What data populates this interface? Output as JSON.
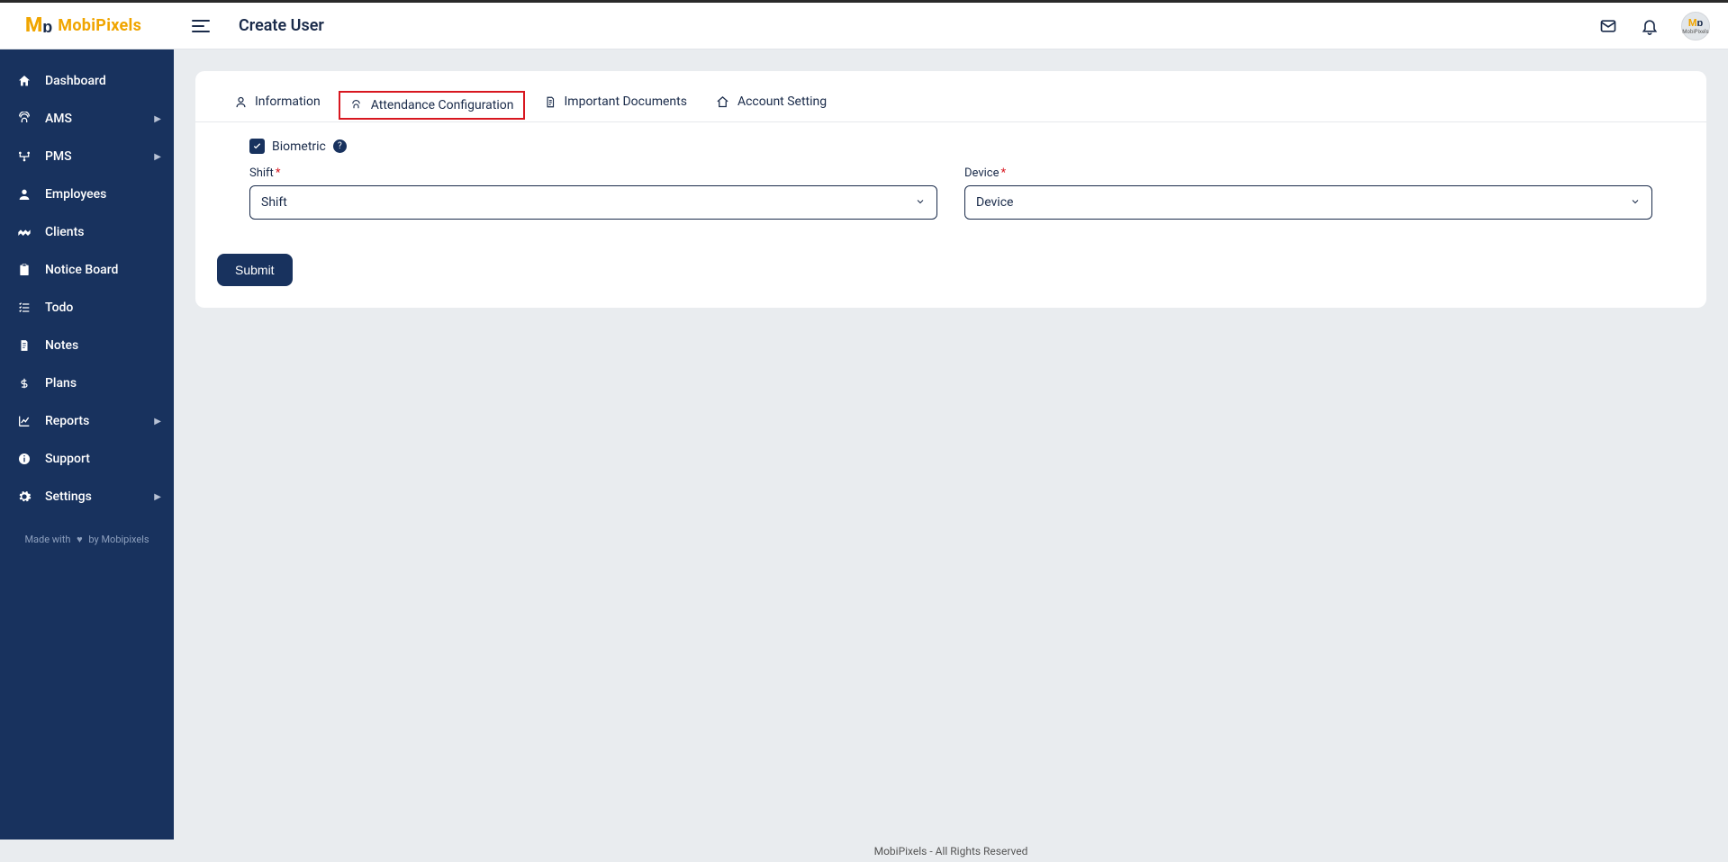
{
  "brand": {
    "logo_text": "MobiPixels"
  },
  "header": {
    "page_title": "Create User",
    "avatar_text": "MobiPixels"
  },
  "sidebar": {
    "items": [
      {
        "label": "Dashboard",
        "icon": "home-icon",
        "expandable": false
      },
      {
        "label": "AMS",
        "icon": "fingerprint-icon",
        "expandable": true
      },
      {
        "label": "PMS",
        "icon": "network-icon",
        "expandable": true
      },
      {
        "label": "Employees",
        "icon": "user-icon",
        "expandable": false
      },
      {
        "label": "Clients",
        "icon": "handshake-icon",
        "expandable": false
      },
      {
        "label": "Notice Board",
        "icon": "clipboard-icon",
        "expandable": false
      },
      {
        "label": "Todo",
        "icon": "list-icon",
        "expandable": false
      },
      {
        "label": "Notes",
        "icon": "note-icon",
        "expandable": false
      },
      {
        "label": "Plans",
        "icon": "dollar-icon",
        "expandable": false
      },
      {
        "label": "Reports",
        "icon": "chart-icon",
        "expandable": true
      },
      {
        "label": "Support",
        "icon": "info-icon",
        "expandable": false
      },
      {
        "label": "Settings",
        "icon": "gear-icon",
        "expandable": true
      }
    ],
    "made_with_prefix": "Made with",
    "made_with_suffix": "by Mobipixels"
  },
  "tabs": [
    {
      "label": "Information",
      "icon": "person-icon",
      "active": false
    },
    {
      "label": "Attendance Configuration",
      "icon": "fingerprint-icon",
      "active": true
    },
    {
      "label": "Important Documents",
      "icon": "document-icon",
      "active": false
    },
    {
      "label": "Account Setting",
      "icon": "home-outline-icon",
      "active": false
    }
  ],
  "form": {
    "biometric_label": "Biometric",
    "biometric_checked": true,
    "help_symbol": "?",
    "shift": {
      "label": "Shift",
      "required": true,
      "placeholder": "Shift"
    },
    "device": {
      "label": "Device",
      "required": true,
      "placeholder": "Device"
    },
    "submit_label": "Submit"
  },
  "footer": {
    "text": "MobiPixels - All Rights Reserved"
  }
}
